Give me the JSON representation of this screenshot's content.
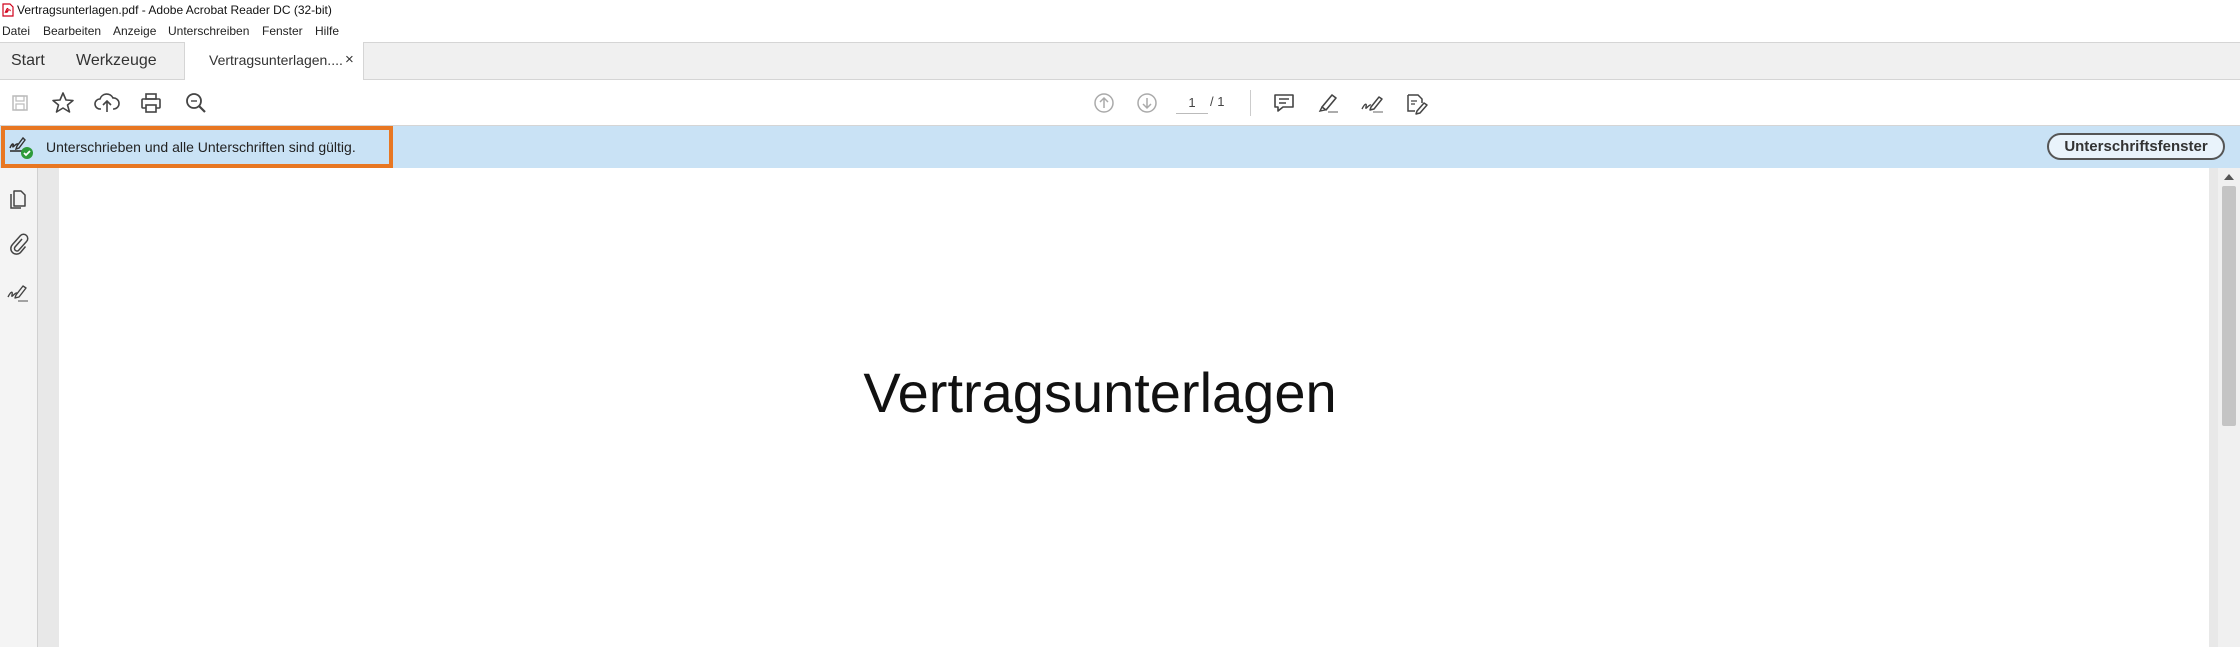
{
  "window": {
    "title": "Vertragsunterlagen.pdf - Adobe Acrobat Reader DC (32-bit)",
    "app_icon": "pdf-icon"
  },
  "menu": [
    "Datei",
    "Bearbeiten",
    "Anzeige",
    "Unterschreiben",
    "Fenster",
    "Hilfe"
  ],
  "tabs": {
    "start": "Start",
    "tools": "Werkzeuge",
    "document": "Vertragsunterlagen....",
    "close_glyph": "×"
  },
  "toolbar": {
    "left_icons": [
      "save-icon",
      "bookmark-star-icon",
      "cloud-upload-icon",
      "print-icon",
      "zoom-search-icon"
    ],
    "nav_icons": [
      "previous-page-icon",
      "next-page-icon"
    ],
    "page_current": "1",
    "page_total": "/ 1",
    "right_icons": [
      "comment-icon",
      "highlight-pen-icon",
      "sign-icon",
      "fill-sign-icon"
    ]
  },
  "signature_bar": {
    "message": "Unterschrieben und alle Unterschriften sind gültig.",
    "panel_button": "Unterschriftsfenster",
    "status_icon": "signature-valid-icon",
    "highlight_color": "#e87722",
    "bar_color": "#c9e2f5"
  },
  "sidebar": {
    "icons": [
      "pages-thumbnail-icon",
      "attachments-paperclip-icon",
      "signatures-icon"
    ]
  },
  "document": {
    "heading": "Vertragsunterlagen"
  }
}
